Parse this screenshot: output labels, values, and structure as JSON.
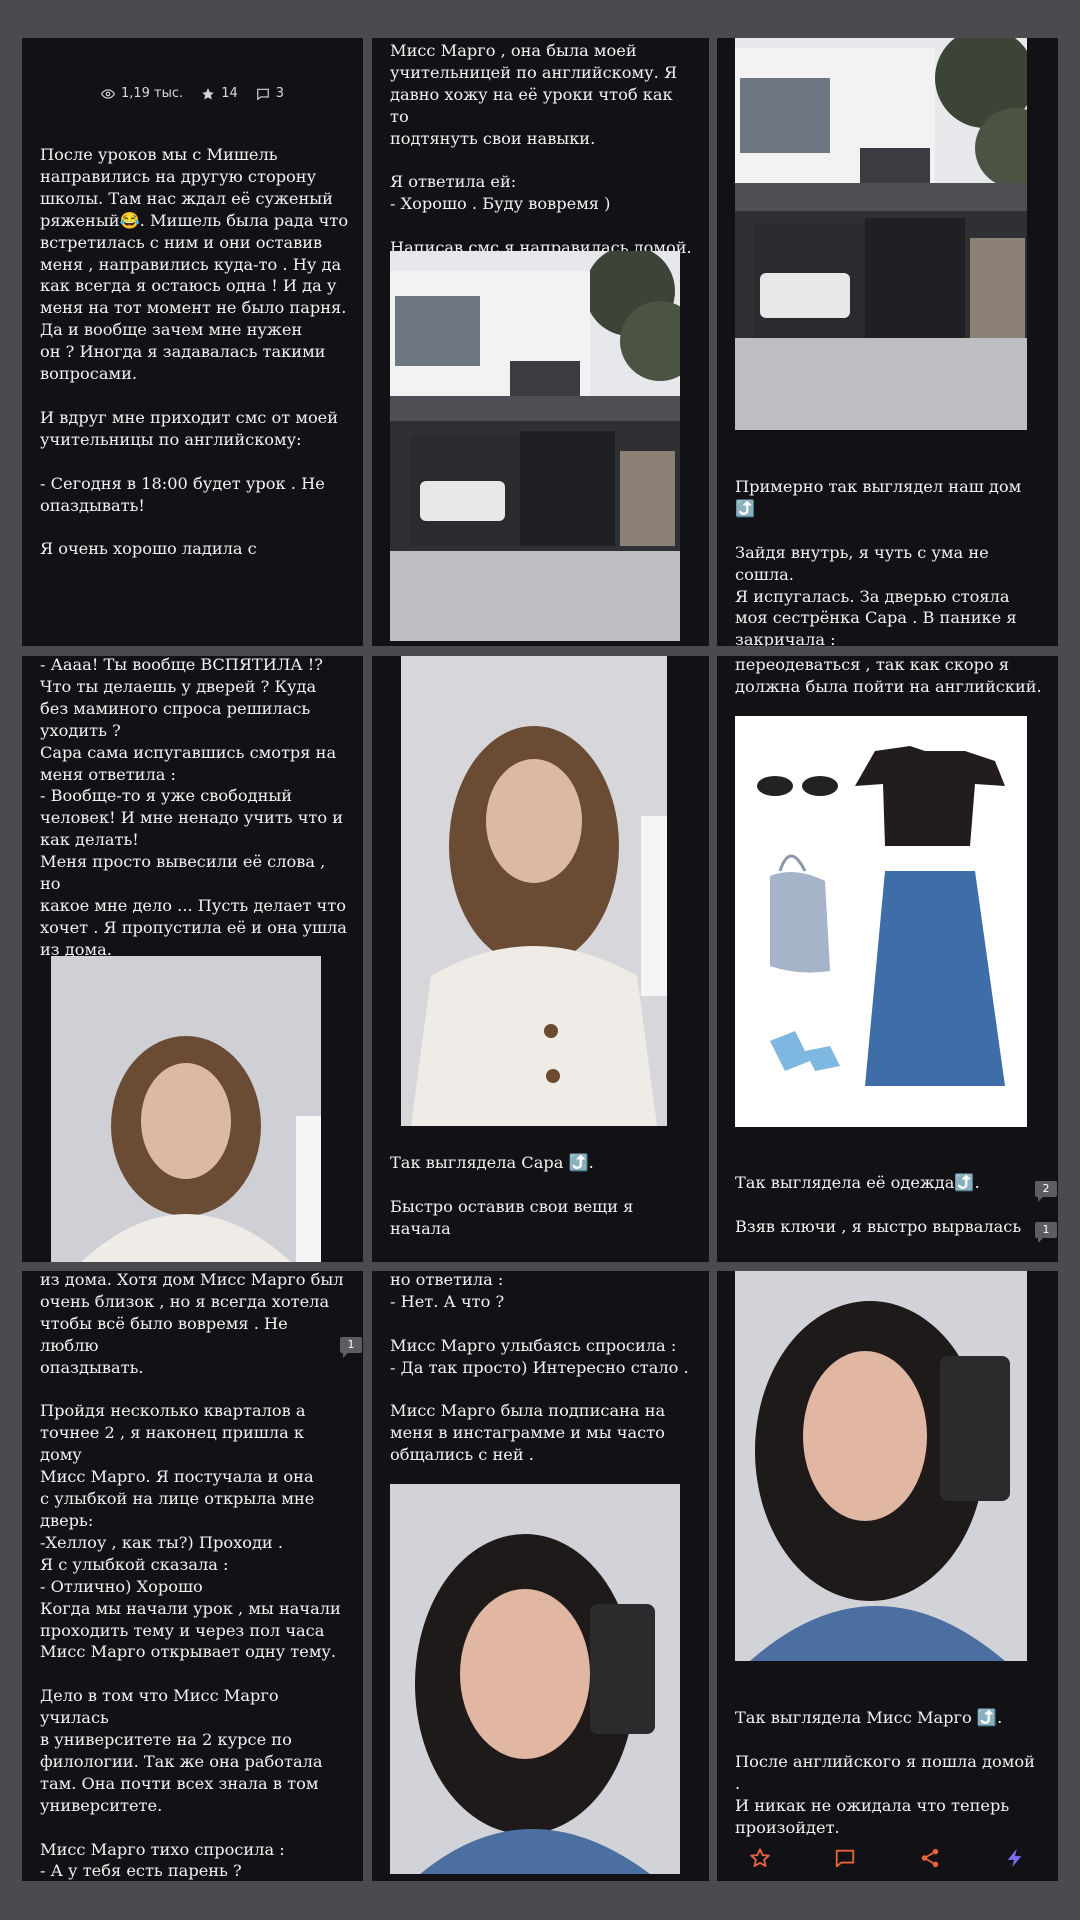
{
  "stats": {
    "views": "1,19 тыс.",
    "stars": "14",
    "comments": "3"
  },
  "pages": {
    "p1": "После уроков мы с Мишель\nнаправились на другую сторону\nшколы. Там нас ждал её суженый\nряженый😂. Мишель была рада что\nвстретилась с ним и они оставив\nменя , направились куда-то . Ну да\nкак всегда я остаюсь одна ! И да у\nменя на тот момент не было парня.\nДа и вообще зачем мне нужен\nон ? Иногда я задавалась такими\nвопросами.\n\nИ вдруг мне приходит смс от моей\nучительницы по английскому:\n\n- Сегодня в 18:00 будет урок . Не\nопаздывать!\n\nЯ очень хорошо ладила с",
    "p2": "Мисс Марго , она была моей\nучительницей по английскому. Я\nдавно хожу на её уроки чтоб как то\nподтянуть свои навыки.\n\nЯ ответила ей:\n- Хорошо . Буду вовремя )\n\nНаписав смс я направилась домой.",
    "p3": "Примерно так выглядел наш дом ⤴️\n\nЗайдя внутрь, я чуть с ума не сошла.\nЯ испугалась. За дверью стояла\nмоя сестрёнка Сара . В панике я\nзакричала :",
    "p4": "- Аааа! Ты вообще ВСПЯТИЛА !?\nЧто ты делаешь у дверей ? Куда\nбез маминого спроса решилась\nуходить ?\nСара сама испугавшись смотря на\nменя ответила :\n- Вообще-то я уже свободный\nчеловек! И мне ненадо учить что и\nкак делать!\nМеня просто вывесили её слова , но\nкакое мне дело ... Пусть делает что\nхочет . Я пропустила её и она ушла\nиз дома.",
    "p5": "Так выглядела Сара ⤴️.\n\nБыстро оставив свои вещи я начала",
    "p6a": "переодеваться , так как скоро я\nдолжна была пойти на английский.",
    "p6b": "Так выглядела её одежда⤴️.\n\nВзяв ключи , я выстро вырвалась",
    "p7": "из дома. Хотя дом Мисс Марго был\nочень близок , но я всегда хотела\nчтобы всё было вовремя . Не люблю\nопаздывать.\n\nПройдя несколько кварталов а\nточнее 2 , я наконец пришла к дому\nМисс Марго. Я постучала и она\nс улыбкой на лице открыла мне\nдверь:\n-Хеллоу , как ты?) Проходи .\nЯ с улыбкой сказала :\n- Отлично) Хорошо\nКогда мы начали урок , мы начали\nпроходить тему и через пол часа\nМисс Марго открывает одну тему.\n\nДело в том что Мисс Марго училась\nв университете на 2 курсе по\nфилологии. Так же она работала\nтам. Она почти всех знала в том\nуниверситете.\n\nМисс Марго тихо спросила :\n- А у тебя есть парень ?\n\nЯ честно не ожидала такого вопроса",
    "p8": "но ответила :\n- Нет. А что ?\n\nМисс Марго улыбаясь спросила :\n- Да так просто) Интересно стало .\n\nМисс Марго была подписана на\nменя в инстаграмме и мы часто\nобщались с ней .",
    "p9": "Так выглядела Мисс Марго ⤴️.\n\nПосле английского я пошла домой .\nИ никак не ожидала что теперь\nпроизойдет."
  },
  "badges": {
    "b1": "2",
    "b2": "1",
    "b3": "1"
  },
  "toolbar_icons": [
    "star-icon",
    "comment-icon",
    "share-icon",
    "lightning-icon"
  ],
  "colors": {
    "accent": "#e8643c",
    "lightning": "#7b6cf0",
    "panel": "#121115",
    "background": "#4b4a4f"
  }
}
